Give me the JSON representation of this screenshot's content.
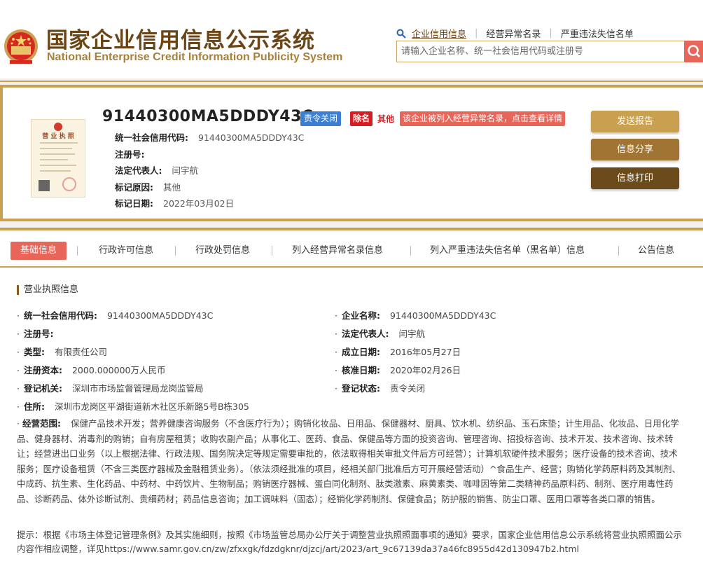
{
  "header": {
    "title_cn": "国家企业信用信息公示系统",
    "title_en": "National Enterprise Credit Information Publicity System",
    "nav": [
      {
        "label": "企业信用信息"
      },
      {
        "label": "经营异常名录"
      },
      {
        "label": "严重违法失信名单"
      }
    ],
    "search": {
      "placeholder": "请输入企业名称、统一社会信用代码或注册号",
      "value": ""
    }
  },
  "summary": {
    "code": "91440300MA5DDDY43C",
    "status_badge": "责令关闭",
    "removed_badge": "除名",
    "other_text": "其他",
    "abnormal_notice": "该企业被列入经营异常名录，点击查看详情",
    "license_title": "营 业 执 照",
    "rows": [
      {
        "label": "统一社会信用代码:",
        "value": "91440300MA5DDDY43C"
      },
      {
        "label": "注册号:",
        "value": ""
      },
      {
        "label": "法定代表人:",
        "value": "闫宇航"
      },
      {
        "label": "标记原因:",
        "value": "其他"
      },
      {
        "label": "标记日期:",
        "value": "2022年03月02日"
      }
    ],
    "buttons": {
      "send": "发送报告",
      "share": "信息分享",
      "print": "信息打印"
    }
  },
  "tabs": [
    {
      "label": "基础信息",
      "active": true
    },
    {
      "label": "行政许可信息"
    },
    {
      "label": "行政处罚信息"
    },
    {
      "label": "列入经营异常名录信息"
    },
    {
      "label": "列入严重违法失信名单（黑名单）信息"
    },
    {
      "label": "公告信息"
    }
  ],
  "business_license": {
    "section_title": "营业执照信息",
    "fields": [
      {
        "label": "统一社会信用代码:",
        "value": "91440300MA5DDDY43C"
      },
      {
        "label": "企业名称:",
        "value": "91440300MA5DDDY43C"
      },
      {
        "label": "注册号:",
        "value": ""
      },
      {
        "label": "法定代表人:",
        "value": "闫宇航"
      },
      {
        "label": "类型:",
        "value": "有限责任公司"
      },
      {
        "label": "成立日期:",
        "value": "2016年05月27日"
      },
      {
        "label": "注册资本:",
        "value": "2000.000000万人民币"
      },
      {
        "label": "核准日期:",
        "value": "2020年02月26日"
      },
      {
        "label": "登记机关:",
        "value": "深圳市市场监督管理局龙岗监管局"
      },
      {
        "label": "登记状态:",
        "value": "责令关闭"
      },
      {
        "label": "住所:",
        "value": "深圳市龙岗区平湖街道新木社区乐新路5号B栋305"
      }
    ],
    "scope_label": "经营范围:",
    "scope_value": "保健产品技术开发；营养健康咨询服务（不含医疗行为）；购销化妆品、日用品、保健器材、厨具、饮水机、纺织品、玉石床垫；计生用品、化妆品、日用化学品、健身器材、消毒剂的购销；自有房屋租赁；收购农副产品；从事化工、医药、食品、保健品等方面的投资咨询、管理咨询、招投标咨询、技术开发、技术咨询、技术转让；经营进出口业务（以上根据法律、行政法规、国务院决定等规定需要审批的，依法取得相关审批文件后方可经营）；计算机软硬件技术服务；医疗设备的技术咨询、技术服务；医疗设备租赁（不含三类医疗器械及金融租赁业务）。（依法须经批准的项目，经相关部门批准后方可开展经营活动）^食品生产、经营；购销化学药原料药及其制剂、中成药、抗生素、生化药品、中药材、中药饮片、生物制品；购销医疗器械、蛋白同化制剂、肽类激素、麻黄素类、咖啡因等第二类精神药品原料药、制剂、医疗用毒性药品、诊断药品、体外诊断试剂、贵细药材；药品信息咨询；加工调味料（固态）；经销化学药制剂、保健食品；防护服的销售、防尘口罩、医用口罩等各类口罩的销售。",
    "notice": "提示：根据《市场主体登记管理条例》及其实施细则，按照《市场监管总局办公厅关于调整营业执照照面事项的通知》要求，国家企业信用信息公示系统将营业执照照面公示内容作相应调整，详见https://www.samr.gov.cn/zw/zfxxgk/fdzdgknr/djzcj/art/2023/art_9c67139da37a46fc8955d42d130947b2.html"
  }
}
